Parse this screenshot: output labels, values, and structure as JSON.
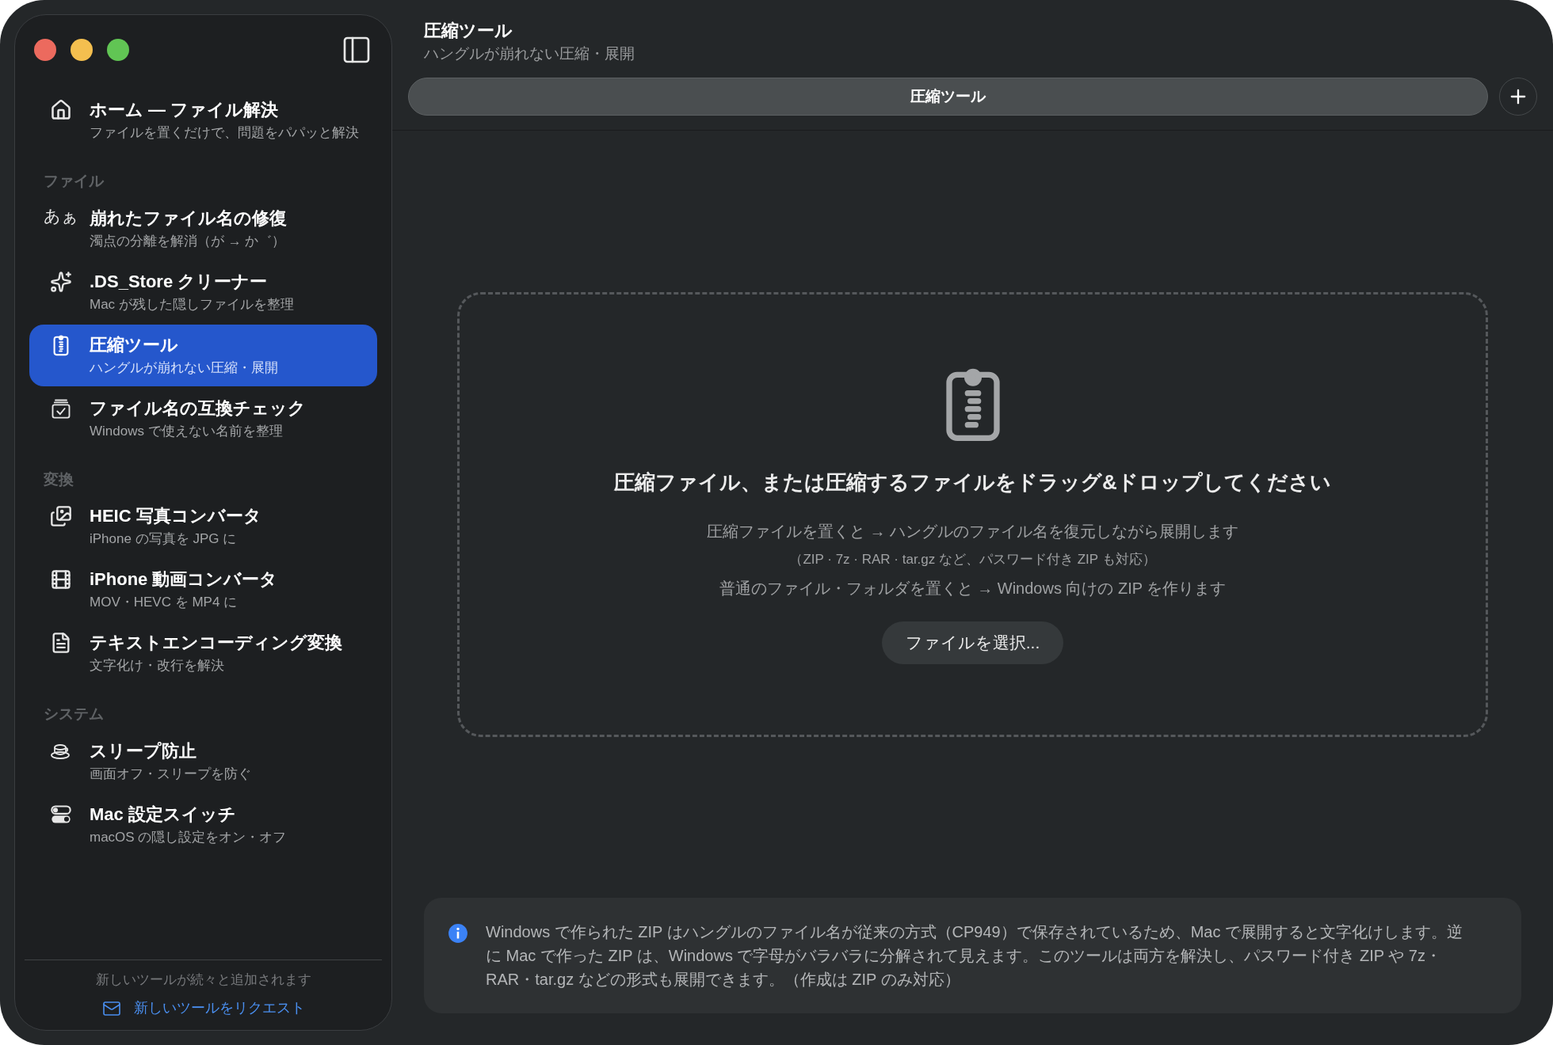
{
  "sidebar": {
    "groups": [
      {
        "items": [
          {
            "kind": "home",
            "title": "ホーム — ファイル解決",
            "subtitle": "ファイルを置くだけで、問題をパパッと解決",
            "selected": false
          }
        ]
      },
      {
        "heading": "ファイル",
        "items": [
          {
            "kind": "text",
            "icon_text": "あぁ",
            "title": "崩れたファイル名の修復",
            "subtitle": "濁点の分離を解消（が → か゛）",
            "selected": false
          },
          {
            "kind": "sparkles",
            "title": ".DS_Store クリーナー",
            "subtitle": "Mac が残した隠しファイルを整理",
            "selected": false
          },
          {
            "kind": "zip",
            "title": "圧縮ツール",
            "subtitle": "ハングルが崩れない圧縮・展開",
            "selected": true
          },
          {
            "kind": "check",
            "title": "ファイル名の互換チェック",
            "subtitle": "Windows で使えない名前を整理",
            "selected": false
          }
        ]
      },
      {
        "heading": "変換",
        "items": [
          {
            "kind": "photos",
            "title": "HEIC 写真コンバータ",
            "subtitle": "iPhone の写真を JPG に",
            "selected": false
          },
          {
            "kind": "film",
            "title": "iPhone 動画コンバータ",
            "subtitle": "MOV・HEVC を MP4 に",
            "selected": false
          },
          {
            "kind": "document",
            "title": "テキストエンコーディング変換",
            "subtitle": "文字化け・改行を解決",
            "selected": false
          }
        ]
      },
      {
        "heading": "システム",
        "items": [
          {
            "kind": "cup",
            "title": "スリープ防止",
            "subtitle": "画面オフ・スリープを防ぐ",
            "selected": false
          },
          {
            "kind": "toggles",
            "title": "Mac 設定スイッチ",
            "subtitle": "macOS の隠し設定をオン・オフ",
            "selected": false
          }
        ]
      }
    ],
    "footer": {
      "note": "新しいツールが続々と追加されます",
      "link": "新しいツールをリクエスト"
    }
  },
  "header": {
    "title": "圧縮ツール",
    "subtitle": "ハングルが崩れない圧縮・展開"
  },
  "tabs": [
    {
      "label": "圧縮ツール",
      "selected": true
    }
  ],
  "dropzone": {
    "heading": "圧縮ファイル、または圧縮するファイルをドラッグ&ドロップしてください",
    "lines": [
      {
        "kind": "main",
        "text": "圧縮ファイルを置くと → ハングルのファイル名を復元しながら展開します"
      },
      {
        "kind": "note",
        "text": "（ZIP · 7z · RAR · tar.gz など、パスワード付き ZIP も対応）"
      },
      {
        "kind": "main",
        "text": "普通のファイル・フォルダを置くと → Windows 向けの ZIP を作ります"
      }
    ],
    "button": "ファイルを選択..."
  },
  "info": {
    "text": "Windows で作られた ZIP はハングルのファイル名が従来の方式（CP949）で保存されているため、Mac で展開すると文字化けします。逆に Mac で作った ZIP は、Windows で字母がバラバラに分解されて見えます。このツールは両方を解決し、パスワード付き ZIP や 7z・RAR・tar.gz などの形式も展開できます。（作成は ZIP のみ対応）"
  }
}
